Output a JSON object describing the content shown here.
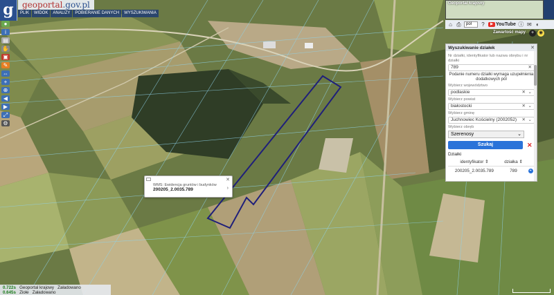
{
  "brand": {
    "part1": "geoportal",
    "part2": ".gov.pl"
  },
  "top_menu": [
    "PLIK",
    "WIDOK",
    "ANALIZY",
    "POBIERANIE DANYCH",
    "WYSZUKIWANIA"
  ],
  "minimap": {
    "label": "Geoportal krajowy"
  },
  "linkbar": {
    "lang": "pol",
    "youtube": "YouTube"
  },
  "collapse_label": "Zawartość mapy",
  "search_panel": {
    "title": "Wyszukiwanie działek",
    "input_label": "Nr działki, identyfikator lub nazwa obrębu i nr działki",
    "input_value": "789",
    "note": "Podanie numeru działki wymaga uzupełnienia dodatkowych pól",
    "wojewodztwo_label": "Wybierz województwo",
    "wojewodztwo_value": "podlaskie",
    "powiat_label": "Wybierz powiat",
    "powiat_value": "białostocki",
    "gmina_label": "Wybierz gminę",
    "gmina_value": "Juchnowiec Kościelny (2002052)",
    "obreb_label": "Wybierz obręb",
    "obreb_value": "Szerenosy",
    "search_button": "Szukaj",
    "results_label": "Działki",
    "columns": [
      "identyfikator",
      "działka"
    ],
    "rows": [
      [
        "200205_2.0035.789",
        "789"
      ]
    ]
  },
  "popup": {
    "header": "WMS: Ewidencja gruntów i budynków",
    "value": "200205_2.0035.789"
  },
  "status": {
    "line1_time": "0.722s",
    "line1_name": "Geoportal krajowy",
    "line1_state": "Załadowano",
    "line2_time": "0.645s",
    "line2_name": "Ziołe",
    "line2_state": "Załadowano"
  },
  "colors": {
    "parcel_outline": "#1f1f7a",
    "primary": "#2a73d9"
  }
}
